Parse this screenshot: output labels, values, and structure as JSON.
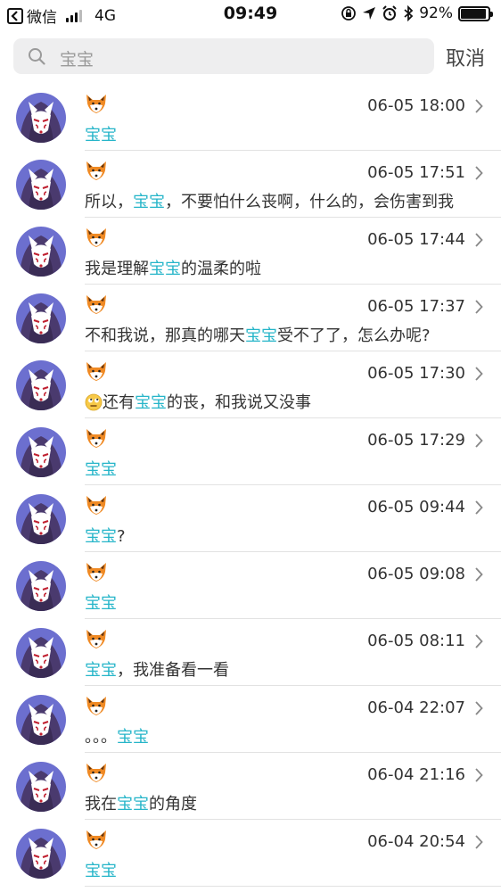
{
  "status_bar": {
    "back_app": "微信",
    "network": "4G",
    "time": "09:49",
    "battery": "92%",
    "battery_level": 0.92
  },
  "search": {
    "query": "宝宝",
    "cancel": "取消"
  },
  "colors": {
    "highlight": "#26b5c9",
    "search_field": "#eeeeef"
  },
  "results": [
    {
      "time": "06-05 18:00",
      "parts": [
        "",
        "宝宝",
        ""
      ]
    },
    {
      "time": "06-05 17:51",
      "parts": [
        "所以，",
        "宝宝",
        "，不要怕什么丧啊，什么的，会伤害到我"
      ]
    },
    {
      "time": "06-05 17:44",
      "parts": [
        "我是理解",
        "宝宝",
        "的温柔的啦"
      ]
    },
    {
      "time": "06-05 17:37",
      "parts": [
        "不和我说，那真的哪天",
        "宝宝",
        "受不了了，怎么办呢?"
      ]
    },
    {
      "time": "06-05 17:30",
      "emoji": "sigh-emoji",
      "parts": [
        "还有",
        "宝宝",
        "的丧，和我说又没事"
      ]
    },
    {
      "time": "06-05 17:29",
      "parts": [
        "",
        "宝宝",
        ""
      ]
    },
    {
      "time": "06-05 09:44",
      "parts": [
        "",
        "宝宝",
        "?"
      ]
    },
    {
      "time": "06-05 09:08",
      "parts": [
        "",
        "宝宝",
        ""
      ]
    },
    {
      "time": "06-05 08:11",
      "parts": [
        "",
        "宝宝",
        "，我准备看一看"
      ]
    },
    {
      "time": "06-04 22:07",
      "parts": [
        "。。。",
        "宝宝",
        ""
      ]
    },
    {
      "time": "06-04 21:16",
      "parts": [
        "我在",
        "宝宝",
        "的角度"
      ]
    },
    {
      "time": "06-04 20:54",
      "parts": [
        "",
        "宝宝",
        ""
      ]
    }
  ]
}
